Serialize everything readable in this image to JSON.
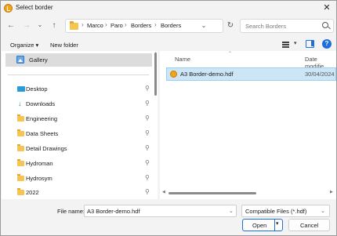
{
  "window": {
    "title": "Select border",
    "close_glyph": "✕"
  },
  "nav": {
    "back_glyph": "←",
    "forward_glyph": "→",
    "recent_glyph": "⌄",
    "up_glyph": "↑",
    "breadcrumb": [
      "Marco",
      "Paro",
      "Borders",
      "Borders"
    ],
    "crumb_sep": "›",
    "dropdown_glyph": "⌄",
    "refresh_glyph": "↻",
    "search_placeholder": "Search Borders"
  },
  "toolbar": {
    "organize_label": "Organize ▾",
    "new_folder_label": "New folder",
    "view_caret": "▾",
    "help_glyph": "?"
  },
  "sidebar": {
    "gallery_label": "Gallery",
    "items": [
      {
        "label": "Desktop",
        "icon": "desktop-icon"
      },
      {
        "label": "Downloads",
        "icon": "downloads-icon"
      },
      {
        "label": "Engineering",
        "icon": "folder-icon"
      },
      {
        "label": "Data Sheets",
        "icon": "folder-icon"
      },
      {
        "label": "Detail Drawings",
        "icon": "folder-icon"
      },
      {
        "label": "Hydroman",
        "icon": "folder-icon"
      },
      {
        "label": "Hydrosym",
        "icon": "folder-icon"
      },
      {
        "label": "2022",
        "icon": "folder-icon"
      }
    ],
    "pin_glyph": "📌"
  },
  "files": {
    "columns": {
      "name": "Name",
      "date": "Date modifie"
    },
    "rows": [
      {
        "name": "A3 Border-demo.hdf",
        "date": "30/04/2024"
      }
    ]
  },
  "footer": {
    "file_name_label": "File name:",
    "file_name_value": "A3 Border-demo.hdf",
    "file_type": "Compatible Files (*.hdf)",
    "open_label": "Open",
    "cancel_label": "Cancel"
  },
  "colors": {
    "accent": "#1e6fd9",
    "selection": "#cde6f7",
    "app_icon": "#f2a51a"
  }
}
